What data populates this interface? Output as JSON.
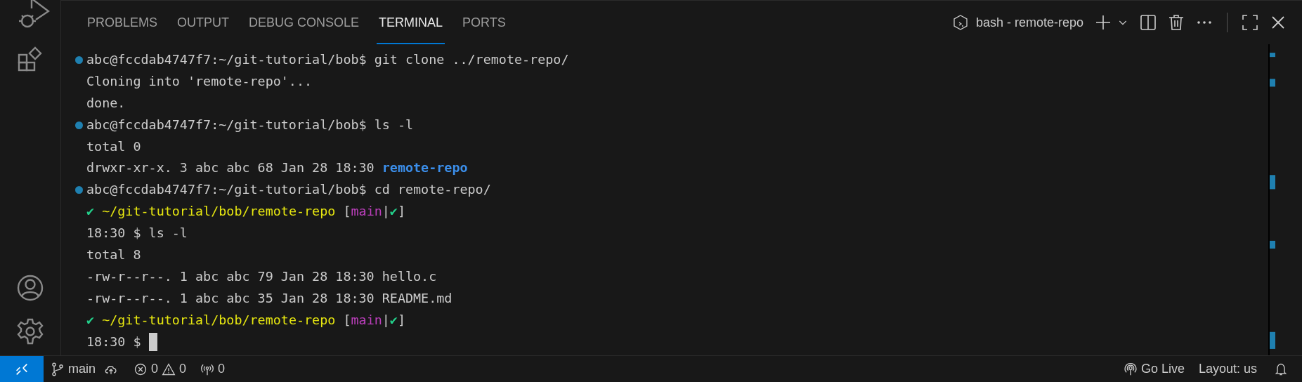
{
  "tabs": [
    {
      "label": "PROBLEMS",
      "selected": false
    },
    {
      "label": "OUTPUT",
      "selected": false
    },
    {
      "label": "DEBUG CONSOLE",
      "selected": false
    },
    {
      "label": "TERMINAL",
      "selected": true
    },
    {
      "label": "PORTS",
      "selected": false
    }
  ],
  "terminal_title": "bash - remote-repo",
  "terminal_lines": [
    {
      "marker": true,
      "spans": [
        {
          "kind": "plain",
          "text": "abc@fccdab4747f7:~/git-tutorial/bob$ git clone ../remote-repo/"
        }
      ]
    },
    {
      "marker": false,
      "spans": [
        {
          "kind": "plain",
          "text": "Cloning into 'remote-repo'..."
        }
      ]
    },
    {
      "marker": false,
      "spans": [
        {
          "kind": "plain",
          "text": "done."
        }
      ]
    },
    {
      "marker": true,
      "spans": [
        {
          "kind": "plain",
          "text": "abc@fccdab4747f7:~/git-tutorial/bob$ ls -l"
        }
      ]
    },
    {
      "marker": false,
      "spans": [
        {
          "kind": "plain",
          "text": "total 0"
        }
      ]
    },
    {
      "marker": false,
      "spans": [
        {
          "kind": "plain",
          "text": "drwxr-xr-x. 3 abc abc 68 Jan 28 18:30 "
        },
        {
          "kind": "dir",
          "text": "remote-repo"
        }
      ]
    },
    {
      "marker": true,
      "spans": [
        {
          "kind": "plain",
          "text": "abc@fccdab4747f7:~/git-tutorial/bob$ cd remote-repo/"
        }
      ]
    },
    {
      "marker": false,
      "spans": [
        {
          "kind": "ok",
          "text": "✔"
        },
        {
          "kind": "path",
          "text": " ~/git-tutorial/bob/remote-repo"
        },
        {
          "kind": "plain",
          "text": " ["
        },
        {
          "kind": "branch",
          "text": "main"
        },
        {
          "kind": "plain",
          "text": "|"
        },
        {
          "kind": "ok",
          "text": "✔"
        },
        {
          "kind": "plain",
          "text": "]"
        }
      ]
    },
    {
      "marker": false,
      "spans": [
        {
          "kind": "plain",
          "text": "18:30 $ ls -l"
        }
      ]
    },
    {
      "marker": false,
      "spans": [
        {
          "kind": "plain",
          "text": "total 8"
        }
      ]
    },
    {
      "marker": false,
      "spans": [
        {
          "kind": "plain",
          "text": "-rw-r--r--. 1 abc abc 79 Jan 28 18:30 hello.c"
        }
      ]
    },
    {
      "marker": false,
      "spans": [
        {
          "kind": "plain",
          "text": "-rw-r--r--. 1 abc abc 35 Jan 28 18:30 README.md"
        }
      ]
    },
    {
      "marker": false,
      "spans": [
        {
          "kind": "ok",
          "text": "✔"
        },
        {
          "kind": "path",
          "text": " ~/git-tutorial/bob/remote-repo"
        },
        {
          "kind": "plain",
          "text": " ["
        },
        {
          "kind": "branch",
          "text": "main"
        },
        {
          "kind": "plain",
          "text": "|"
        },
        {
          "kind": "ok",
          "text": "✔"
        },
        {
          "kind": "plain",
          "text": "]"
        }
      ]
    },
    {
      "marker": false,
      "cursor": true,
      "spans": [
        {
          "kind": "plain",
          "text": "18:30 $ "
        }
      ]
    }
  ],
  "status_bar": {
    "branch": "main",
    "errors": "0",
    "warnings": "0",
    "ports": "0",
    "go_live": "Go Live",
    "layout": "Layout: us"
  }
}
